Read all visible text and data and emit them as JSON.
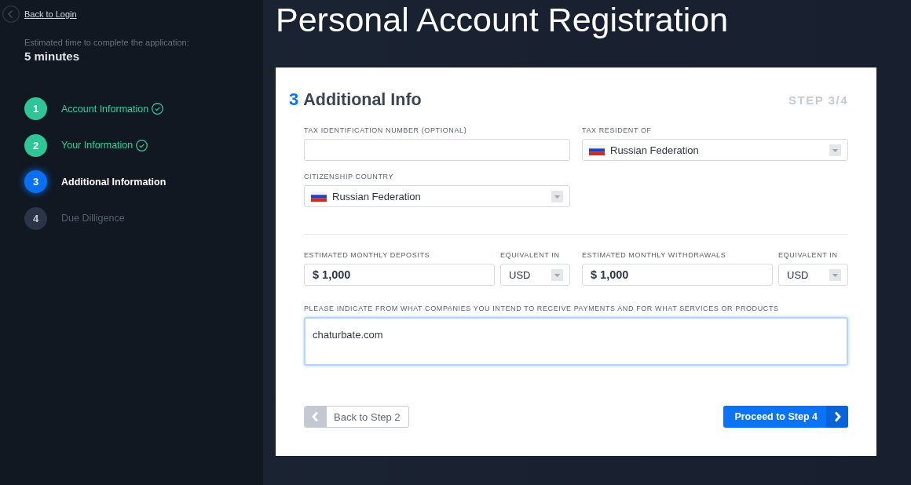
{
  "sidebar": {
    "back_link": "Back to Login",
    "estimate_label": "Estimated time to complete the application:",
    "estimate_value": "5 minutes",
    "steps": [
      {
        "number": "1",
        "label": "Account Information",
        "completed": true,
        "selected": false
      },
      {
        "number": "2",
        "label": "Your Information",
        "completed": true,
        "selected": false
      },
      {
        "number": "3",
        "label": "Additional Information",
        "completed": false,
        "selected": true
      },
      {
        "number": "4",
        "label": "Due Dilligence",
        "completed": false,
        "selected": false
      }
    ]
  },
  "page_title": "Personal Account Registration",
  "form": {
    "step_number": "3",
    "title": "Additional Info",
    "step_indicator": "STEP 3/4",
    "fields": [
      {
        "kind": "text",
        "label": "TAX IDENTIFICATION NUMBER (OPTIONAL)"
      },
      {
        "kind": "country",
        "label": "TAX RESIDENT OF",
        "value": "Russian Federation"
      },
      {
        "kind": "country",
        "label": "CITIZENSHIP COUNTRY",
        "value": "Russian Federation"
      }
    ],
    "amounts": [
      {
        "label": "ESTIMATED MONTHLY DEPOSITS",
        "value": "$ 1,000",
        "currency_label": "EQUIVALENT IN",
        "currency": "USD"
      },
      {
        "label": "ESTIMATED MONTHLY WITHDRAWALS",
        "value": "$ 1,000",
        "currency_label": "EQUIVALENT IN",
        "currency": "USD"
      }
    ],
    "description": {
      "label": "PLEASE INDICATE FROM WHAT COMPANIES YOU INTEND TO RECEIVE PAYMENTS AND FOR WHAT SERVICES OR PRODUCTS",
      "value": "chaturbate.com",
      "focused": true
    },
    "buttons": [
      {
        "kind": "back",
        "label": "Back to Step 2"
      },
      {
        "kind": "next",
        "label": "Proceed to Step 4"
      }
    ]
  }
}
